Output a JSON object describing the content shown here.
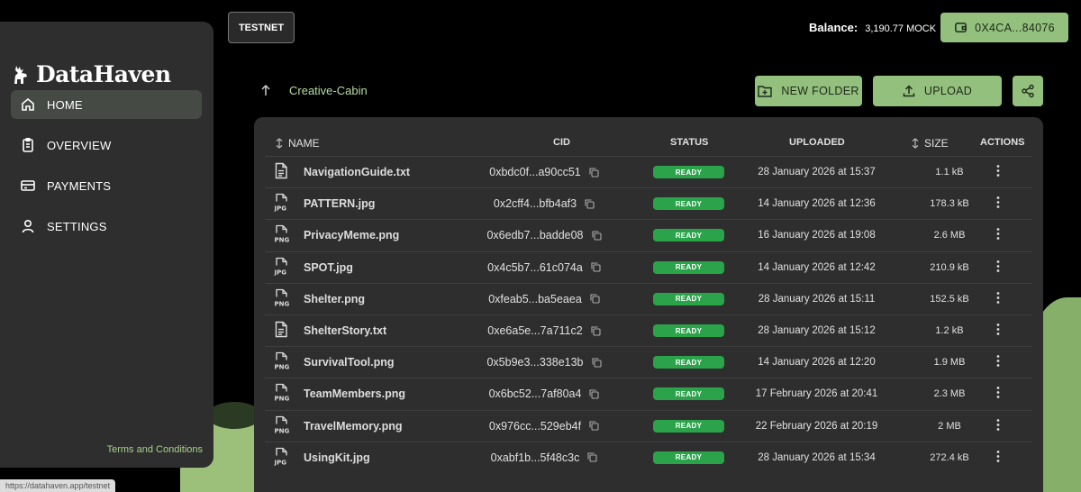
{
  "app": {
    "logo": "DataHaven"
  },
  "sidebar": {
    "items": [
      {
        "label": "HOME",
        "icon": "home-icon",
        "active": true
      },
      {
        "label": "OVERVIEW",
        "icon": "clipboard-icon",
        "active": false
      },
      {
        "label": "PAYMENTS",
        "icon": "credit-card-icon",
        "active": false
      },
      {
        "label": "SETTINGS",
        "icon": "user-icon",
        "active": false
      }
    ],
    "terms": "Terms and Conditions"
  },
  "status_url": "https://datahaven.app/testnet",
  "header": {
    "network": "TESTNET",
    "balance_label": "Balance:",
    "balance_value": "3,190.77 MOCK",
    "wallet": "0X4CA...84076"
  },
  "toolbar": {
    "breadcrumb": "Creative-Cabin",
    "new_folder": "NEW FOLDER",
    "upload": "UPLOAD"
  },
  "table": {
    "columns": {
      "name": "NAME",
      "cid": "CID",
      "status": "STATUS",
      "uploaded": "UPLOADED",
      "size": "SIZE",
      "actions": "ACTIONS"
    },
    "rows": [
      {
        "type": "txt",
        "name": "NavigationGuide.txt",
        "cid": "0xbdc0f...a90cc51",
        "status": "READY",
        "uploaded": "28 January 2026 at 15:37",
        "size": "1.1 kB"
      },
      {
        "type": "jpg",
        "name": "PATTERN.jpg",
        "cid": "0x2cff4...bfb4af3",
        "status": "READY",
        "uploaded": "14 January 2026 at 12:36",
        "size": "178.3 kB"
      },
      {
        "type": "png",
        "name": "PrivacyMeme.png",
        "cid": "0x6edb7...badde08",
        "status": "READY",
        "uploaded": "16 January 2026 at 19:08",
        "size": "2.6 MB"
      },
      {
        "type": "jpg",
        "name": "SPOT.jpg",
        "cid": "0x4c5b7...61c074a",
        "status": "READY",
        "uploaded": "14 January 2026 at 12:42",
        "size": "210.9 kB"
      },
      {
        "type": "png",
        "name": "Shelter.png",
        "cid": "0xfeab5...ba5eaea",
        "status": "READY",
        "uploaded": "28 January 2026 at 15:11",
        "size": "152.5 kB"
      },
      {
        "type": "txt",
        "name": "ShelterStory.txt",
        "cid": "0xe6a5e...7a711c2",
        "status": "READY",
        "uploaded": "28 January 2026 at 15:12",
        "size": "1.2 kB"
      },
      {
        "type": "png",
        "name": "SurvivalTool.png",
        "cid": "0x5b9e3...338e13b",
        "status": "READY",
        "uploaded": "14 January 2026 at 12:20",
        "size": "1.9 MB"
      },
      {
        "type": "png",
        "name": "TeamMembers.png",
        "cid": "0x6bc52...7af80a4",
        "status": "READY",
        "uploaded": "17 February 2026 at 20:41",
        "size": "2.3 MB"
      },
      {
        "type": "png",
        "name": "TravelMemory.png",
        "cid": "0x976cc...529eb4f",
        "status": "READY",
        "uploaded": "22 February 2026 at 20:19",
        "size": "2 MB"
      },
      {
        "type": "jpg",
        "name": "UsingKit.jpg",
        "cid": "0xabf1b...5f48c3c",
        "status": "READY",
        "uploaded": "28 January 2026 at 15:34",
        "size": "272.4 kB"
      }
    ]
  },
  "colors": {
    "accent": "#94c07e",
    "ready": "#2aa34a",
    "panel": "#2e2e2e"
  }
}
